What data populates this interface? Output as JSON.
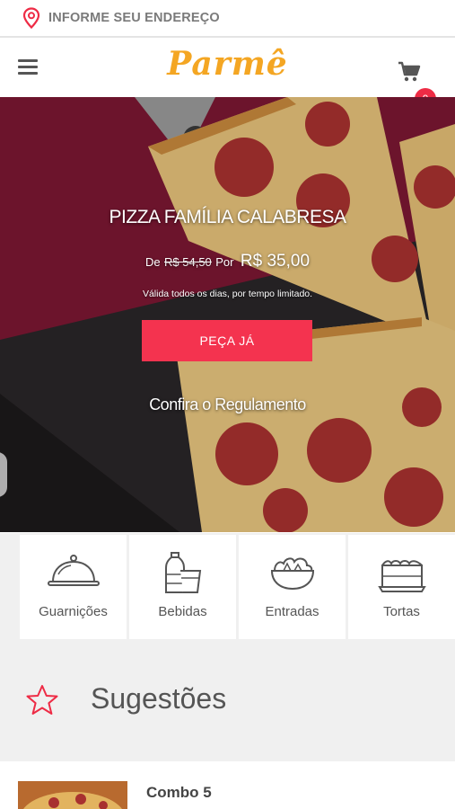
{
  "address_bar": {
    "label": "INFORME SEU ENDEREÇO",
    "icon": "location-pin-icon",
    "icon_color": "#ee2b45"
  },
  "header": {
    "logo": "Parmê",
    "logo_color": "#f4a623",
    "menu_icon": "hamburger-menu-icon",
    "cart_icon": "shopping-cart-icon",
    "cart_count": "0",
    "badge_color": "#ee2b45"
  },
  "hero": {
    "title": "PIZZA FAMÍLIA CALABRESA",
    "price_prefix": "De",
    "old_price": "R$ 54,50",
    "price_mid": "Por",
    "new_price": "R$ 35,00",
    "validity": "Válida todos os dias, por tempo limitado.",
    "cta_label": "PEÇA JÁ",
    "cta_color": "#f4334f",
    "regulation_link": "Confira o Regulamento"
  },
  "categories": [
    {
      "label": "Guarnições",
      "icon": "cloche-icon"
    },
    {
      "label": "Bebidas",
      "icon": "drinks-icon"
    },
    {
      "label": "Entradas",
      "icon": "salad-bowl-icon"
    },
    {
      "label": "Tortas",
      "icon": "cake-icon"
    }
  ],
  "suggestions": {
    "title": "Sugestões",
    "icon": "star-outline-icon",
    "icon_color": "#ee2b45"
  },
  "items": [
    {
      "name": "Combo 5"
    }
  ]
}
